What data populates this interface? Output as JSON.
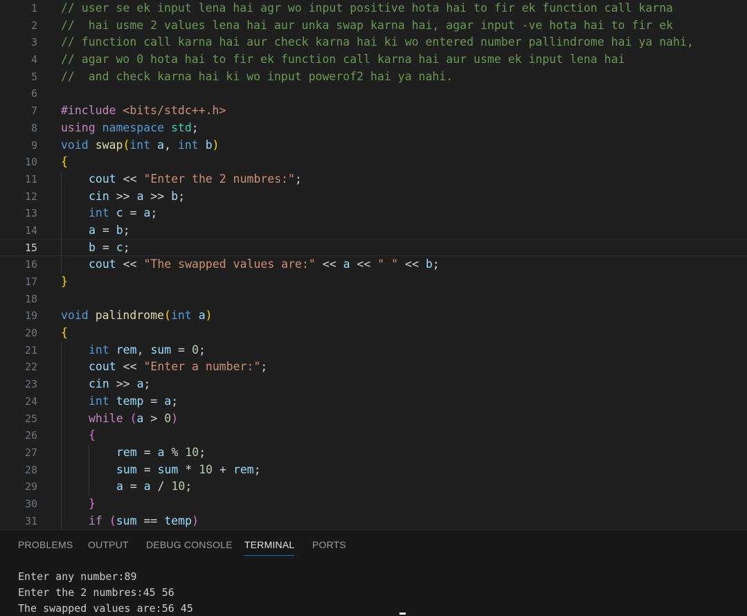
{
  "editor": {
    "current_line": 15,
    "lines": [
      {
        "n": "1",
        "indent": 0,
        "tokens": [
          [
            "cmt",
            "// user se ek input lena hai agr wo input positive hota hai to fir ek function call karna"
          ]
        ]
      },
      {
        "n": "2",
        "indent": 0,
        "tokens": [
          [
            "cmt",
            "//  hai usme 2 values lena hai aur unka swap karna hai, agar input -ve hota hai to fir ek"
          ]
        ]
      },
      {
        "n": "3",
        "indent": 0,
        "tokens": [
          [
            "cmt",
            "// function call karna hai aur check karna hai ki wo entered number pallindrome hai ya nahi,"
          ]
        ]
      },
      {
        "n": "4",
        "indent": 0,
        "tokens": [
          [
            "cmt",
            "// agar wo 0 hota hai to fir ek function call karna hai aur usme ek input lena hai"
          ]
        ]
      },
      {
        "n": "5",
        "indent": 0,
        "tokens": [
          [
            "cmt",
            "//  and check karna hai ki wo input powerof2 hai ya nahi."
          ]
        ]
      },
      {
        "n": "6",
        "indent": 0,
        "tokens": []
      },
      {
        "n": "7",
        "indent": 0,
        "tokens": [
          [
            "ctl",
            "#include"
          ],
          [
            "op",
            " "
          ],
          [
            "str",
            "<bits/stdc++.h>"
          ]
        ]
      },
      {
        "n": "8",
        "indent": 0,
        "tokens": [
          [
            "ctl",
            "using"
          ],
          [
            "op",
            " "
          ],
          [
            "kw",
            "namespace"
          ],
          [
            "op",
            " "
          ],
          [
            "typ",
            "std"
          ],
          [
            "op",
            ";"
          ]
        ]
      },
      {
        "n": "9",
        "indent": 0,
        "tokens": [
          [
            "kw",
            "void"
          ],
          [
            "op",
            " "
          ],
          [
            "fn",
            "swap"
          ],
          [
            "b1",
            "("
          ],
          [
            "kw",
            "int"
          ],
          [
            "op",
            " "
          ],
          [
            "var",
            "a"
          ],
          [
            "op",
            ", "
          ],
          [
            "kw",
            "int"
          ],
          [
            "op",
            " "
          ],
          [
            "var",
            "b"
          ],
          [
            "b1",
            ")"
          ]
        ]
      },
      {
        "n": "10",
        "indent": 0,
        "tokens": [
          [
            "b1",
            "{"
          ]
        ]
      },
      {
        "n": "11",
        "indent": 1,
        "tokens": [
          [
            "var",
            "cout"
          ],
          [
            "op",
            " << "
          ],
          [
            "str",
            "\"Enter the 2 numbres:\""
          ],
          [
            "op",
            ";"
          ]
        ]
      },
      {
        "n": "12",
        "indent": 1,
        "tokens": [
          [
            "var",
            "cin"
          ],
          [
            "op",
            " >> "
          ],
          [
            "var",
            "a"
          ],
          [
            "op",
            " >> "
          ],
          [
            "var",
            "b"
          ],
          [
            "op",
            ";"
          ]
        ]
      },
      {
        "n": "13",
        "indent": 1,
        "tokens": [
          [
            "kw",
            "int"
          ],
          [
            "op",
            " "
          ],
          [
            "var",
            "c"
          ],
          [
            "op",
            " = "
          ],
          [
            "var",
            "a"
          ],
          [
            "op",
            ";"
          ]
        ]
      },
      {
        "n": "14",
        "indent": 1,
        "tokens": [
          [
            "var",
            "a"
          ],
          [
            "op",
            " = "
          ],
          [
            "var",
            "b"
          ],
          [
            "op",
            ";"
          ]
        ]
      },
      {
        "n": "15",
        "indent": 1,
        "tokens": [
          [
            "var",
            "b"
          ],
          [
            "op",
            " = "
          ],
          [
            "var",
            "c"
          ],
          [
            "op",
            ";"
          ]
        ]
      },
      {
        "n": "16",
        "indent": 1,
        "tokens": [
          [
            "var",
            "cout"
          ],
          [
            "op",
            " << "
          ],
          [
            "str",
            "\"The swapped values are:\""
          ],
          [
            "op",
            " << "
          ],
          [
            "var",
            "a"
          ],
          [
            "op",
            " << "
          ],
          [
            "str",
            "\" \""
          ],
          [
            "op",
            " << "
          ],
          [
            "var",
            "b"
          ],
          [
            "op",
            ";"
          ]
        ]
      },
      {
        "n": "17",
        "indent": 0,
        "tokens": [
          [
            "b1",
            "}"
          ]
        ]
      },
      {
        "n": "18",
        "indent": 0,
        "tokens": []
      },
      {
        "n": "19",
        "indent": 0,
        "tokens": [
          [
            "kw",
            "void"
          ],
          [
            "op",
            " "
          ],
          [
            "fn",
            "palindrome"
          ],
          [
            "b1",
            "("
          ],
          [
            "kw",
            "int"
          ],
          [
            "op",
            " "
          ],
          [
            "var",
            "a"
          ],
          [
            "b1",
            ")"
          ]
        ]
      },
      {
        "n": "20",
        "indent": 0,
        "tokens": [
          [
            "b1",
            "{"
          ]
        ]
      },
      {
        "n": "21",
        "indent": 1,
        "tokens": [
          [
            "kw",
            "int"
          ],
          [
            "op",
            " "
          ],
          [
            "var",
            "rem"
          ],
          [
            "op",
            ", "
          ],
          [
            "var",
            "sum"
          ],
          [
            "op",
            " = "
          ],
          [
            "num",
            "0"
          ],
          [
            "op",
            ";"
          ]
        ]
      },
      {
        "n": "22",
        "indent": 1,
        "tokens": [
          [
            "var",
            "cout"
          ],
          [
            "op",
            " << "
          ],
          [
            "str",
            "\"Enter a number:\""
          ],
          [
            "op",
            ";"
          ]
        ]
      },
      {
        "n": "23",
        "indent": 1,
        "tokens": [
          [
            "var",
            "cin"
          ],
          [
            "op",
            " >> "
          ],
          [
            "var",
            "a"
          ],
          [
            "op",
            ";"
          ]
        ]
      },
      {
        "n": "24",
        "indent": 1,
        "tokens": [
          [
            "kw",
            "int"
          ],
          [
            "op",
            " "
          ],
          [
            "var",
            "temp"
          ],
          [
            "op",
            " = "
          ],
          [
            "var",
            "a"
          ],
          [
            "op",
            ";"
          ]
        ]
      },
      {
        "n": "25",
        "indent": 1,
        "tokens": [
          [
            "ctl",
            "while"
          ],
          [
            "op",
            " "
          ],
          [
            "b2",
            "("
          ],
          [
            "var",
            "a"
          ],
          [
            "op",
            " > "
          ],
          [
            "num",
            "0"
          ],
          [
            "b2",
            ")"
          ]
        ]
      },
      {
        "n": "26",
        "indent": 1,
        "tokens": [
          [
            "b2",
            "{"
          ]
        ]
      },
      {
        "n": "27",
        "indent": 2,
        "tokens": [
          [
            "var",
            "rem"
          ],
          [
            "op",
            " = "
          ],
          [
            "var",
            "a"
          ],
          [
            "op",
            " % "
          ],
          [
            "num",
            "10"
          ],
          [
            "op",
            ";"
          ]
        ]
      },
      {
        "n": "28",
        "indent": 2,
        "tokens": [
          [
            "var",
            "sum"
          ],
          [
            "op",
            " = "
          ],
          [
            "var",
            "sum"
          ],
          [
            "op",
            " * "
          ],
          [
            "num",
            "10"
          ],
          [
            "op",
            " + "
          ],
          [
            "var",
            "rem"
          ],
          [
            "op",
            ";"
          ]
        ]
      },
      {
        "n": "29",
        "indent": 2,
        "tokens": [
          [
            "var",
            "a"
          ],
          [
            "op",
            " = "
          ],
          [
            "var",
            "a"
          ],
          [
            "op",
            " / "
          ],
          [
            "num",
            "10"
          ],
          [
            "op",
            ";"
          ]
        ]
      },
      {
        "n": "30",
        "indent": 1,
        "tokens": [
          [
            "b2",
            "}"
          ]
        ]
      },
      {
        "n": "31",
        "indent": 1,
        "tokens": [
          [
            "ctl",
            "if"
          ],
          [
            "op",
            " "
          ],
          [
            "b2",
            "("
          ],
          [
            "var",
            "sum"
          ],
          [
            "op",
            " == "
          ],
          [
            "var",
            "temp"
          ],
          [
            "b2",
            ")"
          ]
        ]
      }
    ]
  },
  "panel": {
    "tabs": [
      "PROBLEMS",
      "OUTPUT",
      "DEBUG CONSOLE",
      "TERMINAL",
      "PORTS"
    ],
    "active_tab": "TERMINAL",
    "terminal_lines": [
      "Enter any number:89",
      "Enter the 2 numbres:45 56",
      "The swapped values are:56 45"
    ]
  }
}
